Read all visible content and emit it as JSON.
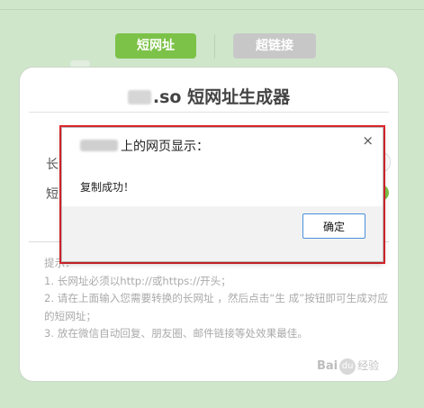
{
  "tabs": {
    "short_url": "短网址",
    "super_link": "超链接"
  },
  "card": {
    "title_suffix": ".so 短网址生成器",
    "long_label": "长",
    "short_label": "短",
    "tips_header": "提示：",
    "tips": [
      "1. 长网址必须以http://或https://开头；",
      "2. 请在上面输入您需要转换的长网址 ，然后点击“生 成”按钮即可生成对应的短网址；",
      "3. 放在微信自动回复、朋友圈、邮件链接等处效果最佳。"
    ]
  },
  "dialog": {
    "title_suffix": "上的网页显示：",
    "close_symbol": "×",
    "message": "复制成功！",
    "ok_label": "确定"
  },
  "watermark": {
    "logo": "Bai",
    "paw": "du",
    "text": "经验"
  },
  "colors": {
    "page_bg": "#cfe6cb",
    "tab_active": "#7cc248",
    "tab_inactive": "#c7c7c7",
    "highlight_border": "#e3262d",
    "button_border": "#4a90d9"
  }
}
